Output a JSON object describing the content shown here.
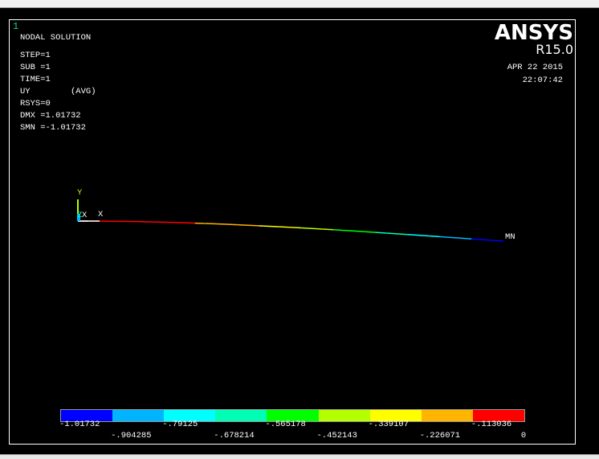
{
  "window_number": "1",
  "header": {
    "title": "NODAL SOLUTION",
    "lines": [
      "STEP=1",
      "SUB =1",
      "TIME=1",
      "UY        (AVG)",
      "RSYS=0",
      "DMX =1.01732",
      "SMN =-1.01732"
    ]
  },
  "logo": {
    "brand": "ANSYS",
    "release": "R15.0",
    "date": "APR 22 2015",
    "time": "22:07:42"
  },
  "triad": {
    "y": "Y",
    "z": "Z",
    "x": "X",
    "x2": "X"
  },
  "min_marker": "MN",
  "contour": {
    "colors": [
      "#0000ff",
      "#00b4ff",
      "#00ffff",
      "#00ffb4",
      "#00ff00",
      "#b4ff00",
      "#ffff00",
      "#ffb400",
      "#ff0000"
    ],
    "labels": [
      "-1.01732",
      "-.904285",
      "-.79125",
      "-.678214",
      "-.565178",
      "-.452143",
      "-.339107",
      "-.226071",
      "-.113036",
      "0"
    ],
    "min": -1.01732,
    "max": 0
  }
}
